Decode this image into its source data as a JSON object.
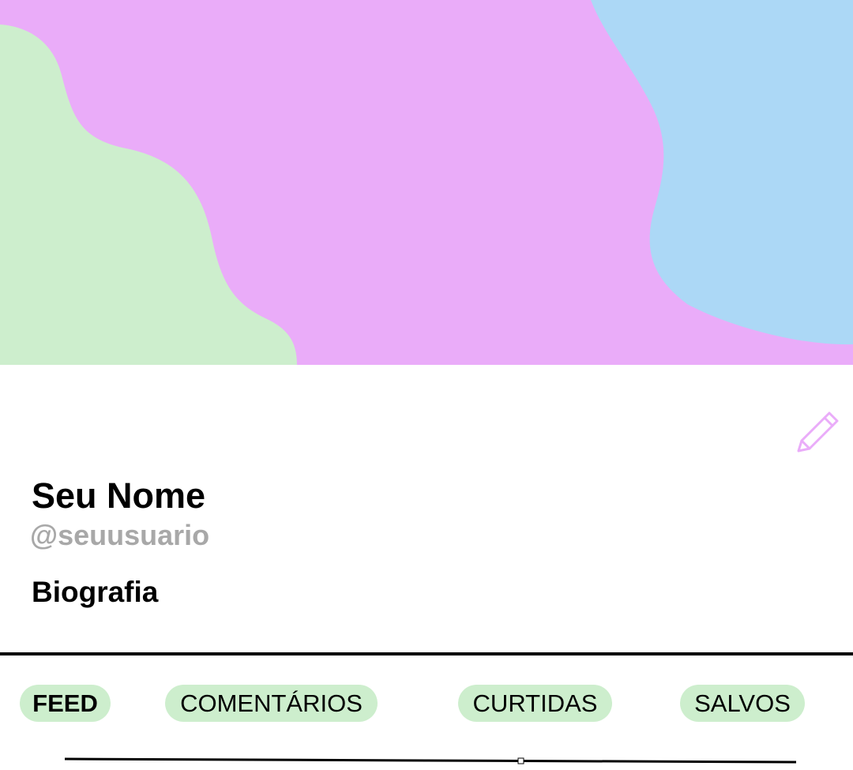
{
  "profile": {
    "name": "Seu Nome",
    "handle": "@seuusuario",
    "bio_heading": "Biografia"
  },
  "actions": {
    "edit_icon": "pencil-icon"
  },
  "tabs": [
    {
      "label": "FEED",
      "active": true
    },
    {
      "label": "COMENTÁRIOS",
      "active": false
    },
    {
      "label": "CURTIDAS",
      "active": false
    },
    {
      "label": "SALVOS",
      "active": false
    }
  ],
  "colors": {
    "cover_main": "#eaacf9",
    "cover_left_blob": "#cdeecd",
    "cover_right_blob": "#acd8f6",
    "accent": "#eaacf9",
    "tab_background": "#cdeecd",
    "handle_text": "#a8a8a8"
  }
}
